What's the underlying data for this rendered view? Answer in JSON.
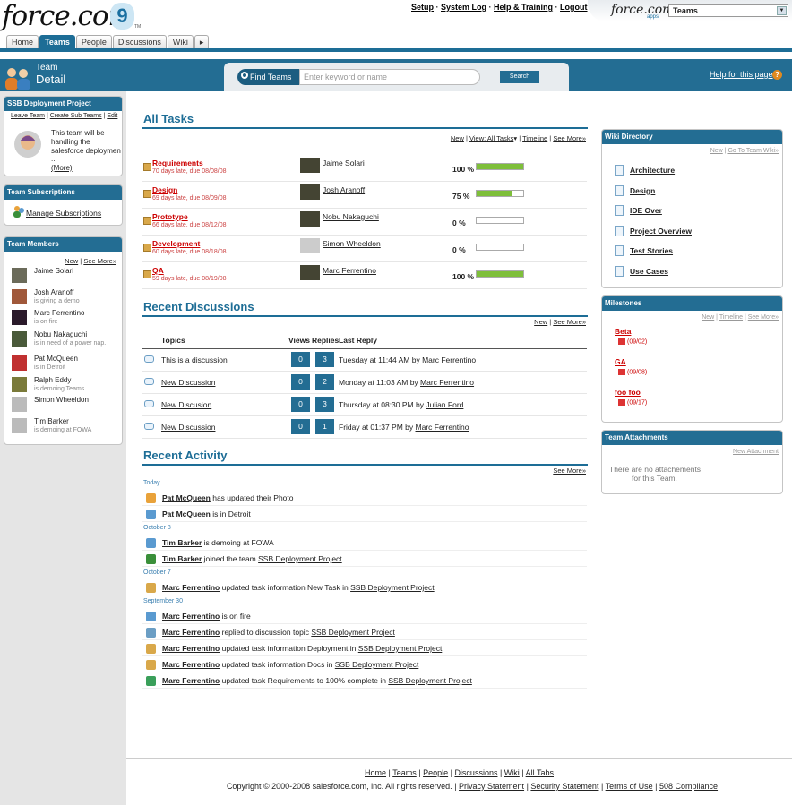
{
  "app": {
    "logo_text": "force.com",
    "logo_badge": "9",
    "logo_tm": "TM",
    "top_links": [
      "Setup",
      "System Log",
      "Help & Training",
      "Logout"
    ],
    "apps_logo": "force.com",
    "apps_sub": "apps",
    "app_selector_value": "Teams"
  },
  "tabs": [
    {
      "label": "Home",
      "active": false
    },
    {
      "label": "Teams",
      "active": true
    },
    {
      "label": "People",
      "active": false
    },
    {
      "label": "Discussions",
      "active": false
    },
    {
      "label": "Wiki",
      "active": false
    },
    {
      "label": "▸",
      "active": false
    }
  ],
  "header": {
    "title_line1": "Team",
    "title_line2": "Detail",
    "find_label": "Find Teams",
    "search_placeholder": "Enter keyword or name",
    "search_button": "Search",
    "help_link": "Help for this page",
    "help_icon": "?"
  },
  "project_box": {
    "title": "SSB Deployment Project",
    "links": [
      "Leave Team",
      "Create Sub Teams",
      "Edit"
    ],
    "description": "This team will be handling the salesforce deploymen",
    "ellipsis": "...",
    "more": "(More)"
  },
  "subscriptions_box": {
    "title": "Team Subscriptions",
    "link": "Manage Subscriptions"
  },
  "members_box": {
    "title": "Team Members",
    "links": [
      "New",
      "See More»"
    ],
    "members": [
      {
        "name": "Jaime Solari",
        "status": "",
        "avatar_color": "#6b6b5a"
      },
      {
        "name": "Josh Aranoff",
        "status": "is giving a demo",
        "avatar_color": "#a0583a"
      },
      {
        "name": "Marc Ferrentino",
        "status": "is on fire",
        "avatar_color": "#2a1a2a"
      },
      {
        "name": "Nobu Nakaguchi",
        "status": "is in need of a power nap.",
        "avatar_color": "#4a5a3a"
      },
      {
        "name": "Pat McQueen",
        "status": "is in Detroit",
        "avatar_color": "#c03030"
      },
      {
        "name": "Ralph Eddy",
        "status": "is demoing Teams",
        "avatar_color": "#7a7a3a"
      },
      {
        "name": "Simon Wheeldon",
        "status": "",
        "avatar_color": "#bbbbbb"
      },
      {
        "name": "Tim Barker",
        "status": "is demoing at FOWA",
        "avatar_color": "#bbbbbb"
      }
    ]
  },
  "tasks": {
    "title": "All Tasks",
    "links": [
      "New",
      "View: All Tasks",
      "Timeline",
      "See More»"
    ],
    "rows": [
      {
        "name": "Requirements",
        "late": "70 days late, due 08/08/08",
        "user": "Jaime Solari",
        "pct_label": "100 %",
        "pct": 100
      },
      {
        "name": "Design",
        "late": "69 days late, due 08/09/08",
        "user": "Josh Aranoff",
        "pct_label": "75 %",
        "pct": 75
      },
      {
        "name": "Prototype",
        "late": "66 days late, due 08/12/08",
        "user": "Nobu Nakaguchi",
        "pct_label": "0 %",
        "pct": 0
      },
      {
        "name": "Development",
        "late": "60 days late, due 08/18/08",
        "user": "Simon Wheeldon",
        "pct_label": "0 %",
        "pct": 0
      },
      {
        "name": "QA",
        "late": "59 days late, due 08/19/08",
        "user": "Marc Ferrentino",
        "pct_label": "100 %",
        "pct": 100
      }
    ]
  },
  "discussions": {
    "title": "Recent Discussions",
    "links": [
      "New",
      "See More»"
    ],
    "headers": [
      "Topics",
      "Views",
      "Replies",
      "Last Reply"
    ],
    "rows": [
      {
        "topic": "This is a discussion",
        "views": "0",
        "replies": "3",
        "last": "Tuesday at 11:44 AM by ",
        "by": "Marc Ferrentino"
      },
      {
        "topic": "New Discussion",
        "views": "0",
        "replies": "2",
        "last": "Monday at 11:03 AM by ",
        "by": "Marc Ferrentino"
      },
      {
        "topic": "New Discusion",
        "views": "0",
        "replies": "3",
        "last": "Thursday at 08:30 PM by ",
        "by": "Julian Ford"
      },
      {
        "topic": "New Discussion",
        "views": "0",
        "replies": "1",
        "last": "Friday at 01:37 PM by ",
        "by": "Marc Ferrentino"
      }
    ]
  },
  "activity": {
    "title": "Recent Activity",
    "see_more": "See More»",
    "groups": [
      {
        "date": "Today",
        "items": [
          {
            "user": "Pat McQueen",
            "text": " has updated their Photo",
            "link": ""
          },
          {
            "user": "Pat McQueen",
            "text": " is in Detroit",
            "link": ""
          }
        ]
      },
      {
        "date": "October 8",
        "items": [
          {
            "user": "Tim Barker",
            "text": " is demoing at FOWA",
            "link": ""
          },
          {
            "user": "Tim Barker",
            "text": " joined the team ",
            "link": "SSB Deployment Project"
          }
        ]
      },
      {
        "date": "October 7",
        "items": [
          {
            "user": "Marc Ferrentino",
            "text": " updated task information New Task in ",
            "link": "SSB Deployment Project"
          }
        ]
      },
      {
        "date": "September 30",
        "items": [
          {
            "user": "Marc Ferrentino",
            "text": " is on fire",
            "link": ""
          },
          {
            "user": "Marc Ferrentino",
            "text": " replied to discussion topic ",
            "link": "SSB Deployment Project"
          },
          {
            "user": "Marc Ferrentino",
            "text": " updated task information Deployment in ",
            "link": "SSB Deployment Project"
          },
          {
            "user": "Marc Ferrentino",
            "text": " updated task information Docs in ",
            "link": "SSB Deployment Project"
          },
          {
            "user": "Marc Ferrentino",
            "text": " updated task Requirements to 100% complete in ",
            "link": "SSB Deployment Project"
          }
        ]
      }
    ]
  },
  "wiki": {
    "title": "Wiki Directory",
    "links": [
      "New",
      "Go To Team Wiki»"
    ],
    "pages": [
      "Architecture",
      "Design",
      "IDE Over",
      "Project Overview",
      "Test Stories",
      "Use Cases"
    ]
  },
  "milestones": {
    "title": "Milestones",
    "links": [
      "New",
      "Timeline",
      "See More»"
    ],
    "items": [
      {
        "name": "Beta",
        "date": "(09/02)"
      },
      {
        "name": "GA",
        "date": "(09/08)"
      },
      {
        "name": "foo foo",
        "date": "(09/17)"
      }
    ]
  },
  "attachments": {
    "title": "Team Attachments",
    "link": "New Attachment",
    "empty_line1": "There are no attachements",
    "empty_line2": "for this Team."
  },
  "footer": {
    "links": [
      "Home",
      "Teams",
      "People",
      "Discussions",
      "Wiki",
      "All Tabs"
    ],
    "copyright": "Copyright © 2000-2008 salesforce.com, inc. All rights reserved. | ",
    "legal_links": [
      "Privacy Statement",
      "Security Statement",
      "Terms of Use",
      "508 Compliance"
    ]
  },
  "colors": {
    "brand": "#236d93",
    "late": "#cc0000",
    "progress": "#7ebf3a"
  }
}
